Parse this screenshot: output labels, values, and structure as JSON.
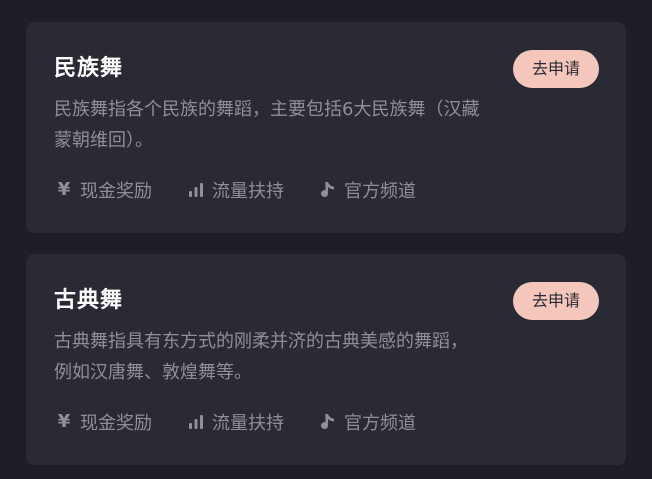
{
  "cards": [
    {
      "title": "民族舞",
      "description": "民族舞指各个民族的舞蹈，主要包括6大民族舞（汉藏蒙朝维回）。",
      "button_label": "去申请",
      "tags": [
        {
          "label": "现金奖励",
          "icon": "yen-icon"
        },
        {
          "label": "流量扶持",
          "icon": "bar-chart-icon"
        },
        {
          "label": "官方频道",
          "icon": "music-note-icon"
        }
      ]
    },
    {
      "title": "古典舞",
      "description": "古典舞指具有东方式的刚柔并济的古典美感的舞蹈，例如汉唐舞、敦煌舞等。",
      "button_label": "去申请",
      "tags": [
        {
          "label": "现金奖励",
          "icon": "yen-icon"
        },
        {
          "label": "流量扶持",
          "icon": "bar-chart-icon"
        },
        {
          "label": "官方频道",
          "icon": "music-note-icon"
        }
      ]
    }
  ],
  "colors": {
    "background": "#1e1e27",
    "card": "#2a2a35",
    "title": "#ffffff",
    "muted_text": "#8f8f99",
    "button_bg": "#f5c6bb"
  },
  "yen_symbol": "¥"
}
